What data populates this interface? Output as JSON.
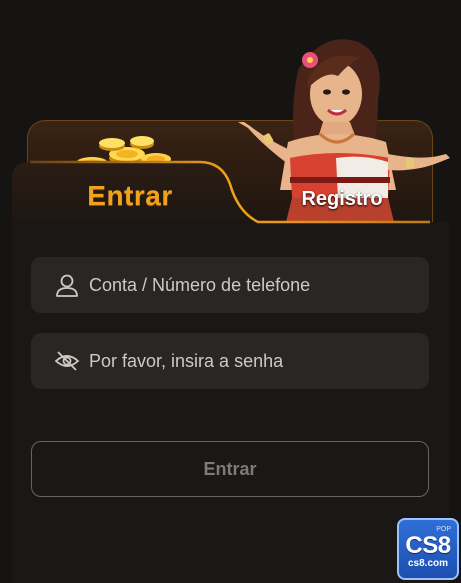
{
  "tabs": {
    "login_label": "Entrar",
    "register_label": "Registro",
    "active": "login"
  },
  "form": {
    "account_placeholder": "Conta / Número de telefone",
    "account_value": "",
    "password_placeholder": "Por favor, insira a senha",
    "password_value": "",
    "submit_label": "Entrar"
  },
  "brand": {
    "top": "POP",
    "main": "CS8",
    "sub": "cs8.com"
  },
  "icons": {
    "account": "user-icon",
    "password": "eye-off-icon"
  },
  "colors": {
    "accent": "#f0a21e",
    "background": "#161413",
    "field": "#2a2624",
    "badge": "#2f6fd6"
  }
}
